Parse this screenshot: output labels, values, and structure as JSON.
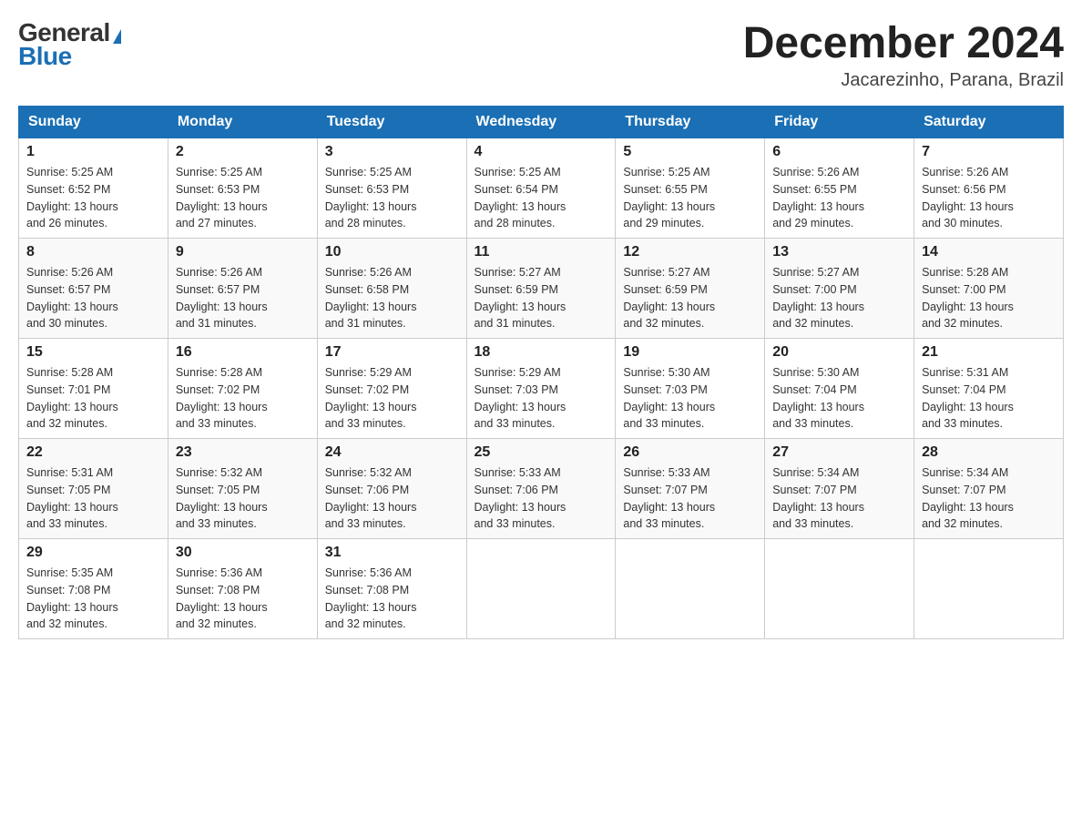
{
  "header": {
    "logo_general": "General",
    "logo_blue": "Blue",
    "month_title": "December 2024",
    "subtitle": "Jacarezinho, Parana, Brazil"
  },
  "weekdays": [
    "Sunday",
    "Monday",
    "Tuesday",
    "Wednesday",
    "Thursday",
    "Friday",
    "Saturday"
  ],
  "weeks": [
    [
      {
        "day": "1",
        "sunrise": "5:25 AM",
        "sunset": "6:52 PM",
        "daylight": "13 hours and 26 minutes."
      },
      {
        "day": "2",
        "sunrise": "5:25 AM",
        "sunset": "6:53 PM",
        "daylight": "13 hours and 27 minutes."
      },
      {
        "day": "3",
        "sunrise": "5:25 AM",
        "sunset": "6:53 PM",
        "daylight": "13 hours and 28 minutes."
      },
      {
        "day": "4",
        "sunrise": "5:25 AM",
        "sunset": "6:54 PM",
        "daylight": "13 hours and 28 minutes."
      },
      {
        "day": "5",
        "sunrise": "5:25 AM",
        "sunset": "6:55 PM",
        "daylight": "13 hours and 29 minutes."
      },
      {
        "day": "6",
        "sunrise": "5:26 AM",
        "sunset": "6:55 PM",
        "daylight": "13 hours and 29 minutes."
      },
      {
        "day": "7",
        "sunrise": "5:26 AM",
        "sunset": "6:56 PM",
        "daylight": "13 hours and 30 minutes."
      }
    ],
    [
      {
        "day": "8",
        "sunrise": "5:26 AM",
        "sunset": "6:57 PM",
        "daylight": "13 hours and 30 minutes."
      },
      {
        "day": "9",
        "sunrise": "5:26 AM",
        "sunset": "6:57 PM",
        "daylight": "13 hours and 31 minutes."
      },
      {
        "day": "10",
        "sunrise": "5:26 AM",
        "sunset": "6:58 PM",
        "daylight": "13 hours and 31 minutes."
      },
      {
        "day": "11",
        "sunrise": "5:27 AM",
        "sunset": "6:59 PM",
        "daylight": "13 hours and 31 minutes."
      },
      {
        "day": "12",
        "sunrise": "5:27 AM",
        "sunset": "6:59 PM",
        "daylight": "13 hours and 32 minutes."
      },
      {
        "day": "13",
        "sunrise": "5:27 AM",
        "sunset": "7:00 PM",
        "daylight": "13 hours and 32 minutes."
      },
      {
        "day": "14",
        "sunrise": "5:28 AM",
        "sunset": "7:00 PM",
        "daylight": "13 hours and 32 minutes."
      }
    ],
    [
      {
        "day": "15",
        "sunrise": "5:28 AM",
        "sunset": "7:01 PM",
        "daylight": "13 hours and 32 minutes."
      },
      {
        "day": "16",
        "sunrise": "5:28 AM",
        "sunset": "7:02 PM",
        "daylight": "13 hours and 33 minutes."
      },
      {
        "day": "17",
        "sunrise": "5:29 AM",
        "sunset": "7:02 PM",
        "daylight": "13 hours and 33 minutes."
      },
      {
        "day": "18",
        "sunrise": "5:29 AM",
        "sunset": "7:03 PM",
        "daylight": "13 hours and 33 minutes."
      },
      {
        "day": "19",
        "sunrise": "5:30 AM",
        "sunset": "7:03 PM",
        "daylight": "13 hours and 33 minutes."
      },
      {
        "day": "20",
        "sunrise": "5:30 AM",
        "sunset": "7:04 PM",
        "daylight": "13 hours and 33 minutes."
      },
      {
        "day": "21",
        "sunrise": "5:31 AM",
        "sunset": "7:04 PM",
        "daylight": "13 hours and 33 minutes."
      }
    ],
    [
      {
        "day": "22",
        "sunrise": "5:31 AM",
        "sunset": "7:05 PM",
        "daylight": "13 hours and 33 minutes."
      },
      {
        "day": "23",
        "sunrise": "5:32 AM",
        "sunset": "7:05 PM",
        "daylight": "13 hours and 33 minutes."
      },
      {
        "day": "24",
        "sunrise": "5:32 AM",
        "sunset": "7:06 PM",
        "daylight": "13 hours and 33 minutes."
      },
      {
        "day": "25",
        "sunrise": "5:33 AM",
        "sunset": "7:06 PM",
        "daylight": "13 hours and 33 minutes."
      },
      {
        "day": "26",
        "sunrise": "5:33 AM",
        "sunset": "7:07 PM",
        "daylight": "13 hours and 33 minutes."
      },
      {
        "day": "27",
        "sunrise": "5:34 AM",
        "sunset": "7:07 PM",
        "daylight": "13 hours and 33 minutes."
      },
      {
        "day": "28",
        "sunrise": "5:34 AM",
        "sunset": "7:07 PM",
        "daylight": "13 hours and 32 minutes."
      }
    ],
    [
      {
        "day": "29",
        "sunrise": "5:35 AM",
        "sunset": "7:08 PM",
        "daylight": "13 hours and 32 minutes."
      },
      {
        "day": "30",
        "sunrise": "5:36 AM",
        "sunset": "7:08 PM",
        "daylight": "13 hours and 32 minutes."
      },
      {
        "day": "31",
        "sunrise": "5:36 AM",
        "sunset": "7:08 PM",
        "daylight": "13 hours and 32 minutes."
      },
      null,
      null,
      null,
      null
    ]
  ],
  "labels": {
    "sunrise": "Sunrise:",
    "sunset": "Sunset:",
    "daylight": "Daylight:"
  }
}
